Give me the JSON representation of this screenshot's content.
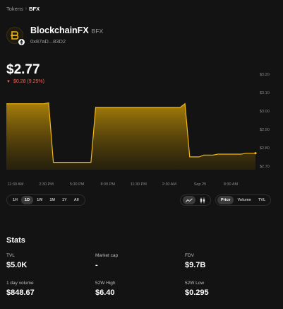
{
  "breadcrumb": {
    "parent": "Tokens",
    "separator": "›",
    "current": "BFX"
  },
  "token": {
    "name": "BlockchainFX",
    "symbol": "BFX",
    "address": "0x87aD...83D2",
    "logo_icon": "bfx-logo-icon",
    "network_icon": "ethereum-icon"
  },
  "price": {
    "current": "$2.77",
    "change": "$0.28 (9.25%)",
    "direction": "down",
    "change_color": "#ff5f52"
  },
  "colors": {
    "accent": "#f5b70f",
    "background": "#131313"
  },
  "chart_data": {
    "type": "area",
    "y_ticks": [
      "$3.20",
      "$3.10",
      "$3.00",
      "$2.90",
      "$2.80",
      "$2.70"
    ],
    "y_tick_values": [
      3.2,
      3.1,
      3.0,
      2.9,
      2.8,
      2.7
    ],
    "x_ticks": [
      "11:30 AM",
      "2:30 PM",
      "5:30 PM",
      "8:30 PM",
      "11:30 PM",
      "2:30 AM",
      "Sep 25",
      "8:30 AM"
    ],
    "ylim": [
      2.68,
      3.22
    ],
    "series": [
      {
        "values": [
          3.04,
          3.04,
          3.04,
          3.04,
          3.04,
          3.04,
          3.04,
          3.04,
          3.04,
          3.045,
          2.72,
          2.72,
          2.72,
          2.72,
          2.72,
          2.72,
          2.72,
          2.72,
          2.72,
          3.02,
          3.02,
          3.02,
          3.02,
          3.02,
          3.02,
          3.02,
          3.02,
          3.02,
          3.02,
          3.02,
          3.02,
          3.02,
          3.02,
          3.02,
          3.02,
          3.02,
          3.02,
          3.02,
          3.04,
          2.75,
          2.75,
          2.75,
          2.76,
          2.76,
          2.76,
          2.765,
          2.765,
          2.765,
          2.765,
          2.765,
          2.765,
          2.77,
          2.77,
          2.77
        ]
      }
    ]
  },
  "ranges": [
    "1H",
    "1D",
    "1W",
    "1M",
    "1Y",
    "All"
  ],
  "active_range": "1D",
  "chart_types": [
    {
      "icon": "line-chart-icon",
      "active": true
    },
    {
      "icon": "candlestick-icon",
      "active": false
    }
  ],
  "metrics": [
    "Price",
    "Volume",
    "TVL"
  ],
  "active_metric": "Price",
  "stats": {
    "title": "Stats",
    "items": [
      {
        "label": "TVL",
        "value": "$5.0K"
      },
      {
        "label": "Market cap",
        "value": "-"
      },
      {
        "label": "FDV",
        "value": "$9.7B"
      },
      {
        "label": "1 day volume",
        "value": "$848.67"
      },
      {
        "label": "52W High",
        "value": "$6.40"
      },
      {
        "label": "52W Low",
        "value": "$0.295"
      }
    ]
  }
}
